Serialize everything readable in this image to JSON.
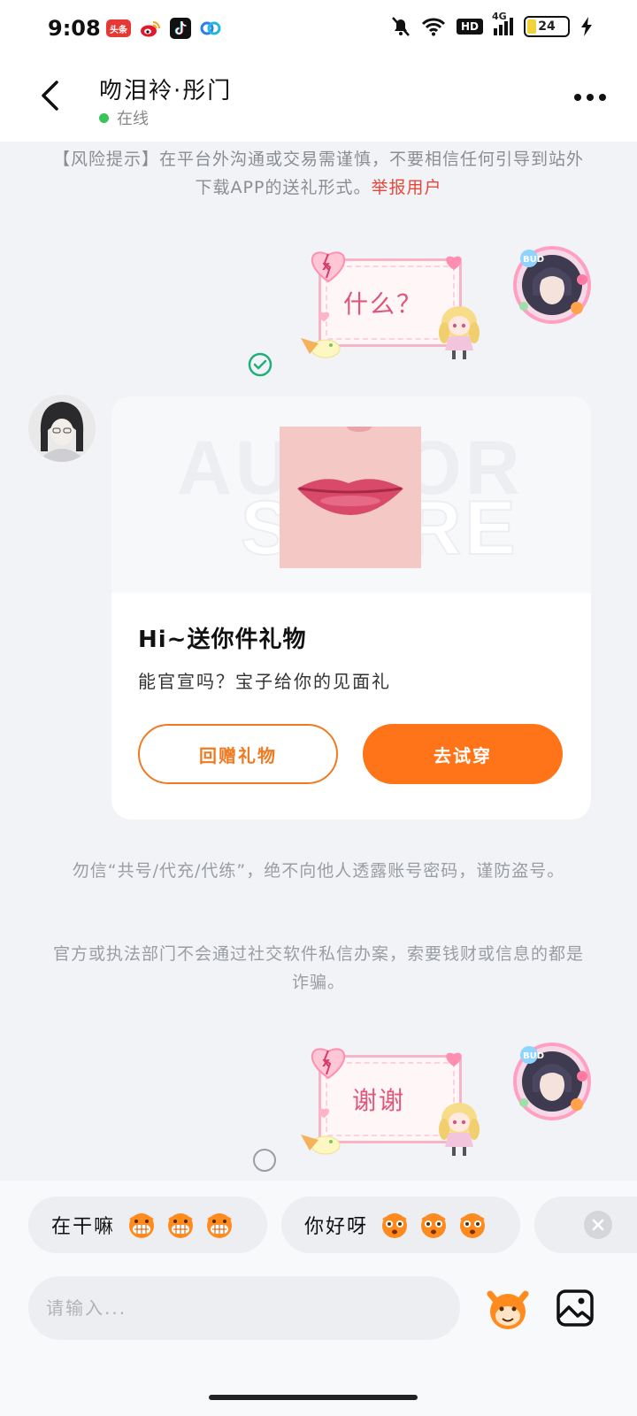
{
  "status_bar": {
    "time": "9:08",
    "app_icons": [
      "头条",
      "微博",
      "抖音",
      "百度网盘"
    ],
    "network_label": "HD",
    "signal_label": "4G",
    "battery_level": "24",
    "colors": {
      "battery_fill": "#f2d23b"
    }
  },
  "header": {
    "back_icon": "back-arrow-icon",
    "contact_name": "吻泪袊·彤门",
    "online_status": "在线",
    "more_icon": "more-dots-icon"
  },
  "risk_notice": {
    "text": "【风险提示】在平台外沟通或交易需谨慎，不要相信任何引导到站外下载APP的送礼形式。",
    "report_link": "举报用户"
  },
  "messages": {
    "sticker_1": {
      "text": "什么？"
    },
    "sticker_2": {
      "text": "谢谢"
    },
    "gift": {
      "watermark_1": "AUTHOR",
      "watermark_2": "STORE",
      "title": "Hi~送你件礼物",
      "subtitle": "能官宣吗？宝子给你的见面礼",
      "return_gift_label": "回赠礼物",
      "try_on_label": "去试穿"
    }
  },
  "tips": {
    "tip_1": "勿信“共号/代充/代练”，绝不向他人透露账号密码，谨防盗号。",
    "tip_2": "官方或执法部门不会通过社交软件私信办案，索要钱财或信息的都是诈骗。"
  },
  "quick_replies": [
    {
      "label": "在干嘛"
    },
    {
      "label": "你好呀"
    }
  ],
  "composer": {
    "placeholder": "请输入...",
    "emoji_icon": "mascot-emoji-icon",
    "image_icon": "image-picker-icon"
  },
  "colors": {
    "accent": "#ff7419",
    "online": "#3bc45a",
    "report_link": "#e5483b",
    "sent_check": "#1fb07a"
  }
}
